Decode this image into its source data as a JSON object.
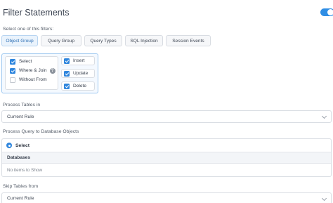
{
  "header": {
    "title": "Filter Statements",
    "toggle_on": true
  },
  "filters": {
    "label": "Select one of this filters:",
    "tabs": [
      {
        "label": "Object Group",
        "active": true
      },
      {
        "label": "Query Group",
        "active": false
      },
      {
        "label": "Query Types",
        "active": false
      },
      {
        "label": "SQL Injection",
        "active": false
      },
      {
        "label": "Session Events",
        "active": false
      }
    ],
    "left_options": [
      {
        "label": "Select",
        "checked": true
      },
      {
        "label": "Where & Join",
        "checked": true,
        "help": "?"
      },
      {
        "label": "Without From",
        "checked": false
      }
    ],
    "right_options": [
      {
        "label": "Insert",
        "checked": true
      },
      {
        "label": "Update",
        "checked": true
      },
      {
        "label": "Delete",
        "checked": true
      }
    ]
  },
  "process_tables": {
    "label": "Process Tables in",
    "value": "Current Rule"
  },
  "process_query": {
    "label": "Process Query to Database Objects",
    "radio_label": "Select",
    "column_header": "Databases",
    "empty_text": "No items to Show"
  },
  "skip_tables": {
    "label": "Skip Tables from",
    "value": "Current Rule"
  },
  "colors": {
    "accent": "#2f86dd",
    "toggle": "#2f8ee5"
  }
}
